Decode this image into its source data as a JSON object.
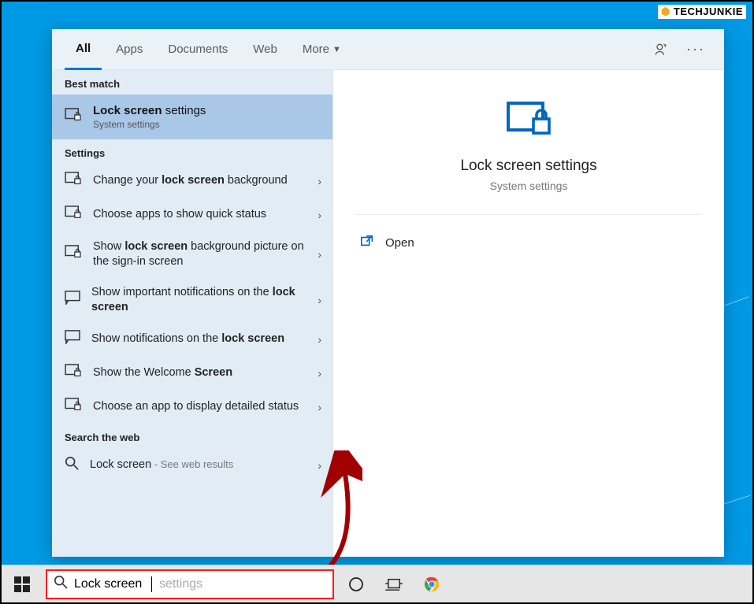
{
  "watermark": "TECHJUNKIE",
  "tabs": {
    "all": "All",
    "apps": "Apps",
    "documents": "Documents",
    "web": "Web",
    "more": "More"
  },
  "section": {
    "bestmatch": "Best match",
    "settings": "Settings",
    "web": "Search the web"
  },
  "best": {
    "title_a": "Lock screen",
    "title_b": " settings",
    "sub": "System settings"
  },
  "rows": [
    {
      "pre": "Change your ",
      "bold": "lock screen",
      "post": " background"
    },
    {
      "pre": "Choose apps to show quick status",
      "bold": "",
      "post": ""
    },
    {
      "pre": "Show ",
      "bold": "lock screen",
      "post": " background picture on the sign-in screen"
    },
    {
      "pre": "Show important notifications on the ",
      "bold": "lock screen",
      "post": ""
    },
    {
      "pre": "Show notifications on the ",
      "bold": "lock screen",
      "post": ""
    },
    {
      "pre": "Show the Welcome ",
      "bold": "Screen",
      "post": ""
    },
    {
      "pre": "Choose an app to display detailed status",
      "bold": "",
      "post": ""
    }
  ],
  "webrow": {
    "text": "Lock screen",
    "sub": " - See web results"
  },
  "preview": {
    "title": "Lock screen settings",
    "sub": "System settings",
    "open": "Open"
  },
  "searchbox": {
    "typed": "Lock screen",
    "ghost": "settings"
  }
}
